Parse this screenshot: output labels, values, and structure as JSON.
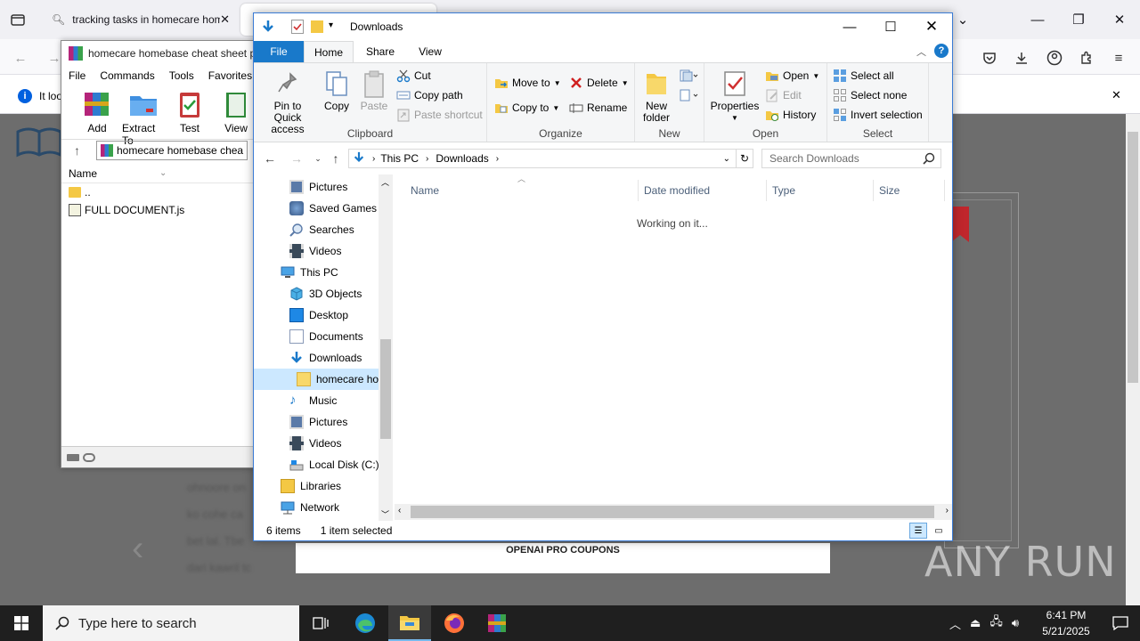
{
  "browser": {
    "tabs": [
      {
        "label": "tracking tasks in homecare hom"
      },
      {
        "label": ""
      }
    ],
    "notification_text": "It loo",
    "page_footer_text": "OPENAI PRO COUPONS",
    "watermark": "ANY RUN"
  },
  "winrar": {
    "title": "homecare homebase cheat sheet p",
    "menu": [
      "File",
      "Commands",
      "Tools",
      "Favorites"
    ],
    "toolbar": [
      "Add",
      "Extract To",
      "Test",
      "View"
    ],
    "path": "homecare homebase chea",
    "column_name": "Name",
    "rows": [
      {
        "name": ".."
      },
      {
        "name": "FULL DOCUMENT.js"
      }
    ]
  },
  "explorer": {
    "title": "Downloads",
    "ribbon_tabs": [
      "File",
      "Home",
      "Share",
      "View"
    ],
    "clipboard": {
      "pin": "Pin to Quick access",
      "copy": "Copy",
      "paste": "Paste",
      "cut": "Cut",
      "copy_path": "Copy path",
      "paste_shortcut": "Paste shortcut",
      "label": "Clipboard"
    },
    "organize": {
      "move_to": "Move to",
      "copy_to": "Copy to",
      "delete": "Delete",
      "rename": "Rename",
      "label": "Organize"
    },
    "new": {
      "new_folder": "New folder",
      "label": "New"
    },
    "open": {
      "properties": "Properties",
      "open": "Open",
      "edit": "Edit",
      "history": "History",
      "label": "Open"
    },
    "select": {
      "select_all": "Select all",
      "select_none": "Select none",
      "invert": "Invert selection",
      "label": "Select"
    },
    "breadcrumb": [
      "This PC",
      "Downloads"
    ],
    "search_placeholder": "Search Downloads",
    "nav_items": [
      {
        "label": "Pictures",
        "icon": "pictures-icon"
      },
      {
        "label": "Saved Games",
        "icon": "saved-games-icon"
      },
      {
        "label": "Searches",
        "icon": "search-icon"
      },
      {
        "label": "Videos",
        "icon": "videos-icon"
      },
      {
        "label": "This PC",
        "icon": "computer-icon"
      },
      {
        "label": "3D Objects",
        "icon": "3d-objects-icon"
      },
      {
        "label": "Desktop",
        "icon": "desktop-icon"
      },
      {
        "label": "Documents",
        "icon": "documents-icon"
      },
      {
        "label": "Downloads",
        "icon": "downloads-icon"
      },
      {
        "label": "homecare ho",
        "icon": "folder-icon"
      },
      {
        "label": "Music",
        "icon": "music-icon"
      },
      {
        "label": "Pictures",
        "icon": "pictures-icon"
      },
      {
        "label": "Videos",
        "icon": "videos-icon"
      },
      {
        "label": "Local Disk (C:)",
        "icon": "disk-icon"
      },
      {
        "label": "Libraries",
        "icon": "libraries-icon"
      },
      {
        "label": "Network",
        "icon": "network-icon"
      }
    ],
    "columns": [
      "Name",
      "Date modified",
      "Type",
      "Size"
    ],
    "working_text": "Working on it...",
    "status_items": "6 items",
    "status_selected": "1 item selected"
  },
  "taskbar": {
    "search_placeholder": "Type here to search",
    "time": "6:41 PM",
    "date": "5/21/2025"
  },
  "colors": {
    "accent": "#1979ca",
    "selection": "#cce8ff",
    "taskbar": "#1f1f1f"
  }
}
